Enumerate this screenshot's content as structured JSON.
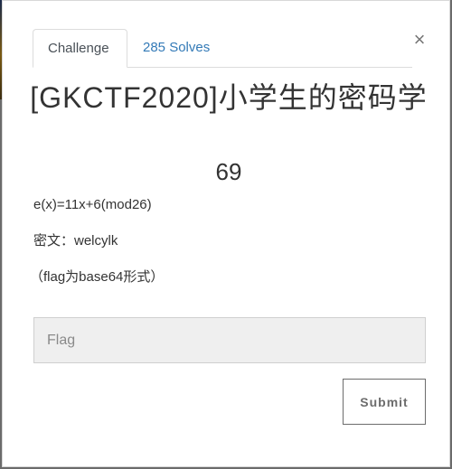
{
  "modal": {
    "close_glyph": "×",
    "tabs": [
      {
        "label": "Challenge",
        "active": true
      },
      {
        "label": "285 Solves",
        "active": false
      }
    ],
    "title": "[GKCTF2020]小学生的密码学",
    "value": "69",
    "description": [
      "e(x)=11x+6(mod26)",
      "密文：welcylk",
      "（flag为base64形式）"
    ],
    "flag_input": {
      "placeholder": "Flag",
      "value": ""
    },
    "submit_label": "Submit"
  },
  "colors": {
    "link": "#337ab7",
    "input_bg": "#efefef",
    "submit_border": "#6c6c6c"
  }
}
